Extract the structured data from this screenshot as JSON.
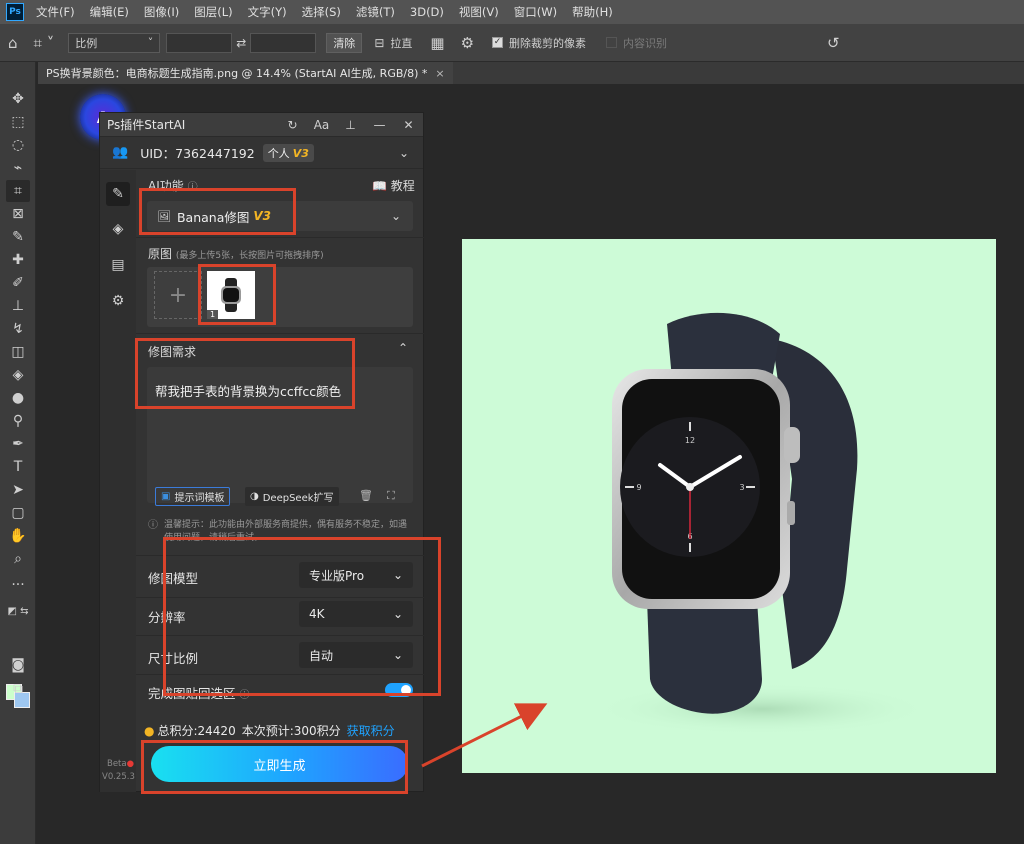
{
  "menubar": {
    "logo": "Ps",
    "items": [
      "文件(F)",
      "编辑(E)",
      "图像(I)",
      "图层(L)",
      "文字(Y)",
      "选择(S)",
      "滤镜(T)",
      "3D(D)",
      "视图(V)",
      "窗口(W)",
      "帮助(H)"
    ]
  },
  "options": {
    "ratio_select": "比例",
    "clear_button": "清除",
    "straighten_label": "拉直",
    "delete_cropped_label": "删除裁剪的像素",
    "content_aware_label": "内容识别"
  },
  "document": {
    "tab_title": "PS换背景颜色：电商标题生成指南.png @ 14.4% (StartAI AI生成, RGB/8) *",
    "close": "×"
  },
  "plugin": {
    "title": "Ps插件StartAI",
    "uid": "UID：7362447192",
    "plan_badge": "个人",
    "plan_version": "V3",
    "ai_function_label": "AI功能",
    "tutorial_label": "教程",
    "feature_name": "Banana修图",
    "feature_version": "V3",
    "source_label": "原图",
    "source_hint": "(最多上传5张，长按图片可拖拽排序)",
    "thumb_index": "1",
    "request_label": "修图需求",
    "request_text": "帮我把手表的背景换为ccffcc颜色",
    "template_button": "提示词模板",
    "deepseek_button": "DeepSeek扩写",
    "notice": "温馨提示：此功能由外部服务商提供，偶有服务不稳定，如遇使用问题，请稍后重试。",
    "settings": [
      {
        "label": "修图模型",
        "value": "专业版Pro"
      },
      {
        "label": "分辨率",
        "value": "4K"
      },
      {
        "label": "尺寸比例",
        "value": "自动"
      }
    ],
    "paste_back_label": "完成图贴回选区",
    "points_total": "总积分:24420",
    "points_cost": "本次预计:300积分",
    "get_points": "获取积分",
    "generate_button": "立即生成",
    "beta_label": "Beta",
    "version_label": "V0.25.3"
  },
  "colors": {
    "canvas_bg": "#ccffcc",
    "accent": "#1fa3ff",
    "annotation": "#d9432b",
    "v3_badge": "#f3b524"
  }
}
